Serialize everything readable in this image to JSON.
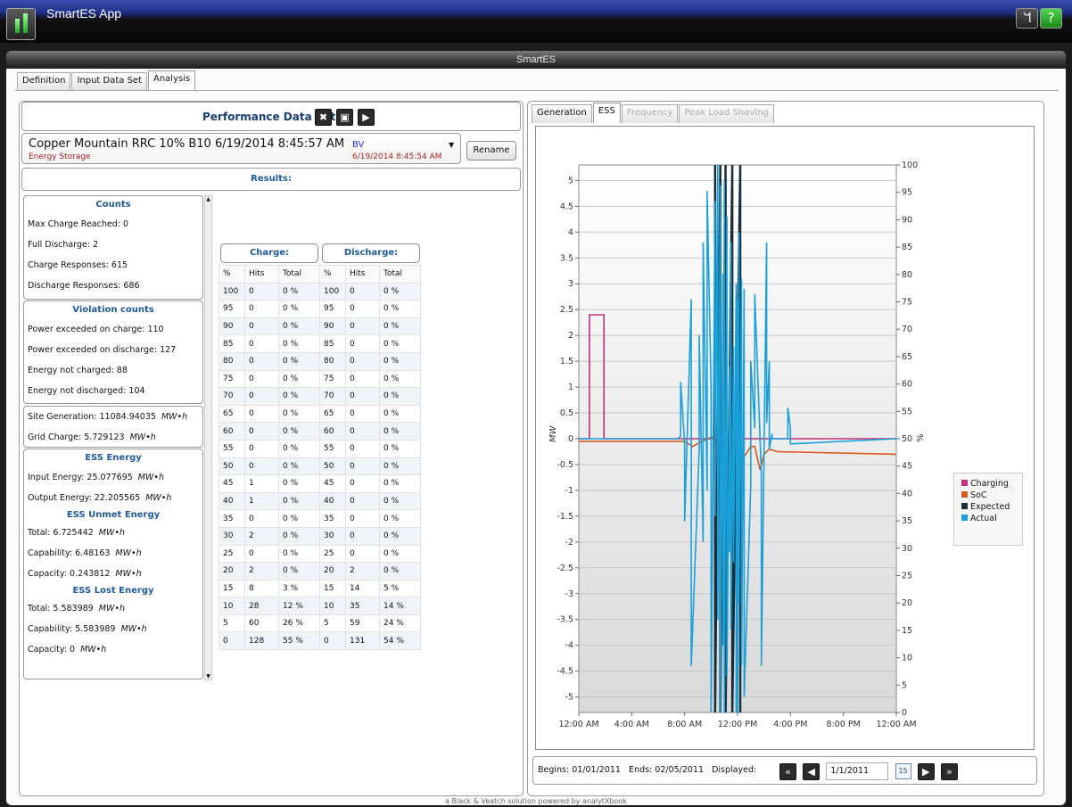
{
  "app": {
    "title": "SmartES App",
    "window_title": "SmartES",
    "wifi_icon": "ᖻ",
    "help_icon": "?"
  },
  "tabs": [
    "Definition",
    "Input Data Set",
    "Analysis"
  ],
  "perf": {
    "title": "Performance Data Set",
    "dataset": "Copper Mountain RRC 10% B10 6/19/2014 8:45:57 AM",
    "user": "BV",
    "type": "Energy Storage",
    "timestamp": "6/19/2014 8:45:54 AM",
    "rename": "Rename"
  },
  "results_title": "Results:",
  "counts": {
    "title": "Counts",
    "lines": [
      "Max Charge Reached: 0",
      "Full Discharge: 2",
      "Charge Responses: 615",
      "Discharge Responses: 686"
    ]
  },
  "violations": {
    "title": "Violation counts",
    "lines": [
      "Power exceeded on charge: 110",
      "Power exceeded on discharge: 127",
      "Energy not charged: 88",
      "Energy not discharged: 104"
    ]
  },
  "generation": {
    "site": "Site Generation: 11084.94035",
    "grid": "Grid Charge: 5.729123",
    "unit": "MW•h"
  },
  "ess_energy": {
    "title": "ESS Energy",
    "input": "Input Energy: 25.077695",
    "output": "Output Energy: 22.205565"
  },
  "unmet": {
    "title": "ESS Unmet Energy",
    "total": "Total: 6.725442",
    "capability": "Capability: 6.48163",
    "capacity": "Capacity: 0.243812"
  },
  "lost": {
    "title": "ESS Lost Energy",
    "total": "Total: 5.583989",
    "capability": "Capability: 5.583989",
    "capacity": "Capacity: 0"
  },
  "charge_header": "Charge:",
  "discharge_header": "Discharge:",
  "col_headers": [
    "%",
    "Hits",
    "Total"
  ],
  "table": [
    [
      "100",
      "0",
      "0 %",
      "100",
      "0",
      "0 %"
    ],
    [
      "95",
      "0",
      "0 %",
      "95",
      "0",
      "0 %"
    ],
    [
      "90",
      "0",
      "0 %",
      "90",
      "0",
      "0 %"
    ],
    [
      "85",
      "0",
      "0 %",
      "85",
      "0",
      "0 %"
    ],
    [
      "80",
      "0",
      "0 %",
      "80",
      "0",
      "0 %"
    ],
    [
      "75",
      "0",
      "0 %",
      "75",
      "0",
      "0 %"
    ],
    [
      "70",
      "0",
      "0 %",
      "70",
      "0",
      "0 %"
    ],
    [
      "65",
      "0",
      "0 %",
      "65",
      "0",
      "0 %"
    ],
    [
      "60",
      "0",
      "0 %",
      "60",
      "0",
      "0 %"
    ],
    [
      "55",
      "0",
      "0 %",
      "55",
      "0",
      "0 %"
    ],
    [
      "50",
      "0",
      "0 %",
      "50",
      "0",
      "0 %"
    ],
    [
      "45",
      "1",
      "0 %",
      "45",
      "0",
      "0 %"
    ],
    [
      "40",
      "1",
      "0 %",
      "40",
      "0",
      "0 %"
    ],
    [
      "35",
      "0",
      "0 %",
      "35",
      "0",
      "0 %"
    ],
    [
      "30",
      "2",
      "0 %",
      "30",
      "0",
      "0 %"
    ],
    [
      "25",
      "0",
      "0 %",
      "25",
      "0",
      "0 %"
    ],
    [
      "20",
      "2",
      "0 %",
      "20",
      "2",
      "0 %"
    ],
    [
      "15",
      "8",
      "3 %",
      "15",
      "14",
      "5 %"
    ],
    [
      "10",
      "28",
      "12 %",
      "10",
      "35",
      "14 %"
    ],
    [
      "5",
      "60",
      "26 %",
      "5",
      "59",
      "24 %"
    ],
    [
      "0",
      "128",
      "55 %",
      "0",
      "131",
      "54 %"
    ]
  ],
  "chart_tabs": [
    "Generation",
    "ESS",
    "Frequency",
    "Peak Load Shaving"
  ],
  "nav": {
    "begins": "Begins: 01/01/2011",
    "ends": "Ends: 02/05/2011",
    "displayed_label": "Displayed:",
    "date": "1/1/2011",
    "calendar_day": "15"
  },
  "footer": "a Black & Veatch solution powered by analytXbook",
  "chart_data": {
    "type": "line",
    "x_ticks": [
      "12:00 AM",
      "4:00 AM",
      "8:00 AM",
      "12:00 PM",
      "4:00 PM",
      "8:00 PM",
      "12:00 AM"
    ],
    "y_left_label": "MW",
    "y_left_ticks": [
      "5",
      "4.5",
      "4",
      "3.5",
      "3",
      "2.5",
      "2",
      "1.5",
      "1",
      "0.5",
      "0",
      "-0.5",
      "-1",
      "-1.5",
      "-2",
      "-2.5",
      "-3",
      "-3.5",
      "-4",
      "-4.5",
      "-5"
    ],
    "y_right_label": "%",
    "y_right_ticks": [
      "100",
      "95",
      "90",
      "85",
      "80",
      "75",
      "70",
      "65",
      "60",
      "55",
      "50",
      "45",
      "40",
      "35",
      "30",
      "25",
      "20",
      "15",
      "10",
      "5",
      "0"
    ],
    "ylim_left": [
      -5.3,
      5.3
    ],
    "ylim_right": [
      0,
      100
    ],
    "xlim_hours": [
      0,
      24
    ],
    "legend": [
      "Charging",
      "SoC",
      "Expected",
      "Actual"
    ],
    "colors": {
      "Charging": "#c0307a",
      "SoC": "#d45a1e",
      "Expected": "#1c2d3a",
      "Actual": "#1aa0d8"
    },
    "series": [
      {
        "name": "Charging",
        "x": [
          0,
          0.8,
          0.8,
          1.9,
          1.9,
          24
        ],
        "y": [
          0,
          0,
          2.4,
          2.4,
          0,
          0
        ]
      },
      {
        "name": "SoC",
        "x": [
          0,
          8,
          8.6,
          9.3,
          10.2,
          10.6,
          10.8,
          11.0,
          11.6,
          12.0,
          12.5,
          13.0,
          13.3,
          13.7,
          14.0,
          14.4,
          15.0,
          24
        ],
        "y": [
          -0.05,
          -0.05,
          -0.15,
          -0.05,
          0.05,
          -0.2,
          -0.7,
          -1.35,
          -0.6,
          -0.5,
          -0.35,
          -0.15,
          -0.15,
          -0.6,
          -0.3,
          -0.2,
          -0.25,
          -0.3
        ]
      },
      {
        "name": "Expected",
        "x": [
          10.3,
          10.3,
          10.7,
          10.7,
          11.1,
          11.1,
          11.6,
          11.6,
          12.2,
          12.2
        ],
        "y": [
          5.3,
          -5.3,
          5.3,
          -5.3,
          5.3,
          -5.3,
          5.3,
          -5.3,
          5.3,
          -5.3
        ]
      },
      {
        "name": "Actual",
        "x": [
          0,
          7.5,
          7.7,
          7.7,
          8.0,
          8.0,
          8.5,
          8.5,
          9.1,
          9.1,
          9.4,
          9.4,
          9.7,
          9.7,
          10.0,
          10.0,
          10.3,
          10.3,
          10.5,
          10.5,
          10.7,
          10.7,
          10.9,
          10.9,
          11.0,
          11.0,
          11.2,
          11.2,
          11.4,
          11.4,
          11.5,
          11.5,
          11.7,
          11.7,
          11.9,
          11.9,
          12.0,
          12.0,
          12.1,
          12.1,
          12.3,
          12.3,
          12.5,
          12.5,
          13.0,
          13.0,
          13.3,
          13.3,
          13.8,
          13.8,
          14.2,
          14.2,
          14.4,
          14.4,
          14.6,
          14.6,
          15.8,
          15.8,
          16.0,
          16.0,
          24
        ],
        "y": [
          0,
          0,
          0.05,
          1.1,
          -0.1,
          -1.6,
          2.7,
          -4.4,
          -0.2,
          2.0,
          -2.0,
          3.8,
          -1.0,
          4.8,
          1.0,
          -5.3,
          4.6,
          -1.5,
          5.3,
          -3.5,
          4.9,
          -5.3,
          3.2,
          -4.0,
          5.0,
          -5.3,
          4.3,
          -4.6,
          1.4,
          -2.2,
          3.8,
          -3.7,
          1.8,
          -2.4,
          3.0,
          -5.3,
          2.7,
          -5.3,
          4.0,
          -3.2,
          3.1,
          -4.4,
          2.9,
          -5.0,
          -0.9,
          1.5,
          0.2,
          2.8,
          -0.7,
          -4.4,
          3.8,
          0.3,
          1.5,
          -0.2,
          0.1,
          0,
          0,
          0.6,
          0.2,
          -0.1,
          0
        ]
      }
    ]
  }
}
